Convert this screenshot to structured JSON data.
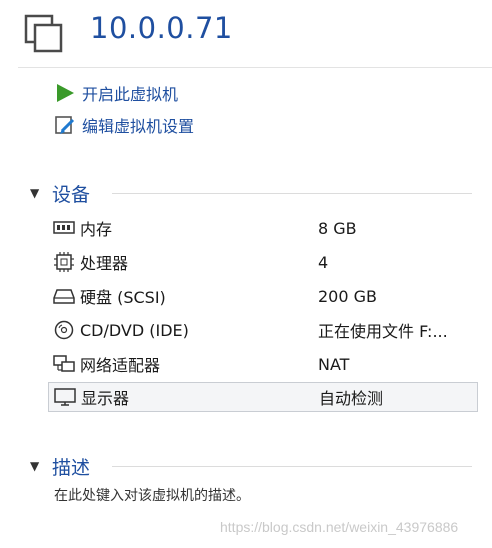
{
  "header": {
    "title": "10.0.0.71"
  },
  "actions": [
    {
      "label": "开启此虚拟机",
      "icon": "play-icon"
    },
    {
      "label": "编辑虚拟机设置",
      "icon": "edit-settings-icon"
    }
  ],
  "devices_section": {
    "title": "设备",
    "items": [
      {
        "name": "内存",
        "value": "8 GB",
        "icon": "memory-icon"
      },
      {
        "name": "处理器",
        "value": "4",
        "icon": "processor-icon"
      },
      {
        "name": "硬盘 (SCSI)",
        "value": "200 GB",
        "icon": "hard-disk-icon"
      },
      {
        "name": "CD/DVD (IDE)",
        "value": "正在使用文件 F:...",
        "icon": "cd-dvd-icon"
      },
      {
        "name": "网络适配器",
        "value": "NAT",
        "icon": "network-adapter-icon"
      },
      {
        "name": "显示器",
        "value": "自动检测",
        "icon": "display-icon",
        "selected": true
      }
    ]
  },
  "description_section": {
    "title": "描述",
    "placeholder": "在此处键入对该虚拟机的描述。"
  },
  "watermark": "https://blog.csdn.net/weixin_43976886",
  "colors": {
    "accent": "#1f4fa0",
    "play_green": "#3a9a2a"
  }
}
